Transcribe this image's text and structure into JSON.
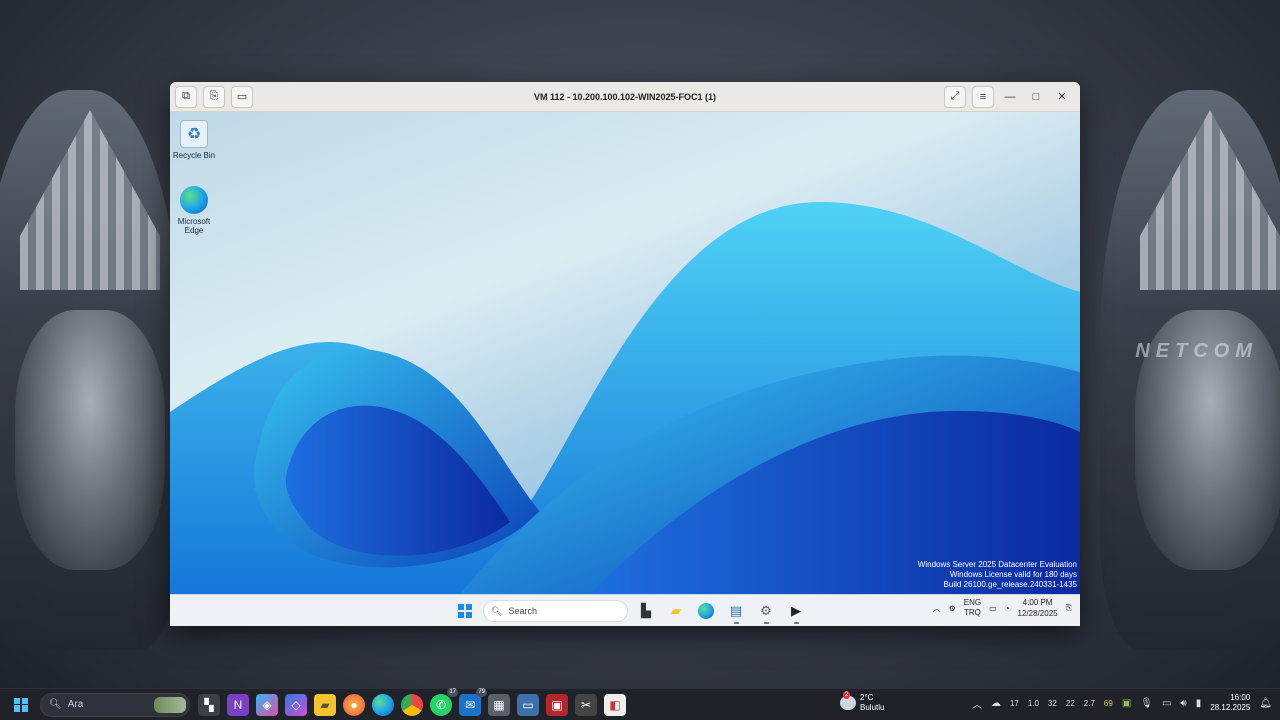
{
  "vm_window": {
    "title": "VM 112 - 10.200.100.102-WIN2025-FOC1 (1)",
    "toolbar_icons": [
      "send-keys-icon",
      "clipboard-icon",
      "monitor-icon"
    ],
    "right_icons": [
      "fullscreen-icon",
      "menu-icon"
    ]
  },
  "guest": {
    "desktop_icons": [
      {
        "label": "Recycle Bin",
        "icon": "recycle-bin-icon"
      },
      {
        "label": "Microsoft Edge",
        "icon": "edge-icon"
      }
    ],
    "evaluation": {
      "line1": "Windows Server 2025 Datacenter Evaluation",
      "line2": "Windows License valid for 180 days",
      "line3": "Build 26100.ge_release.240331-1435"
    },
    "taskbar": {
      "search_placeholder": "Search",
      "lang_top": "ENG",
      "lang_bottom": "TRQ",
      "time": "4:00 PM",
      "date": "12/28/2025"
    }
  },
  "host": {
    "watermark": "NETCOM",
    "search_placeholder": "Ara",
    "badges": {
      "whatsapp": "17",
      "mail": "79"
    },
    "weather": {
      "temp": "2°C",
      "desc": "Bulutlu",
      "badge": "2"
    },
    "tray_values": [
      "17",
      "1.0",
      "32",
      "22",
      "2.7",
      "69"
    ],
    "time": "16:00",
    "date": "28.12.2025"
  }
}
